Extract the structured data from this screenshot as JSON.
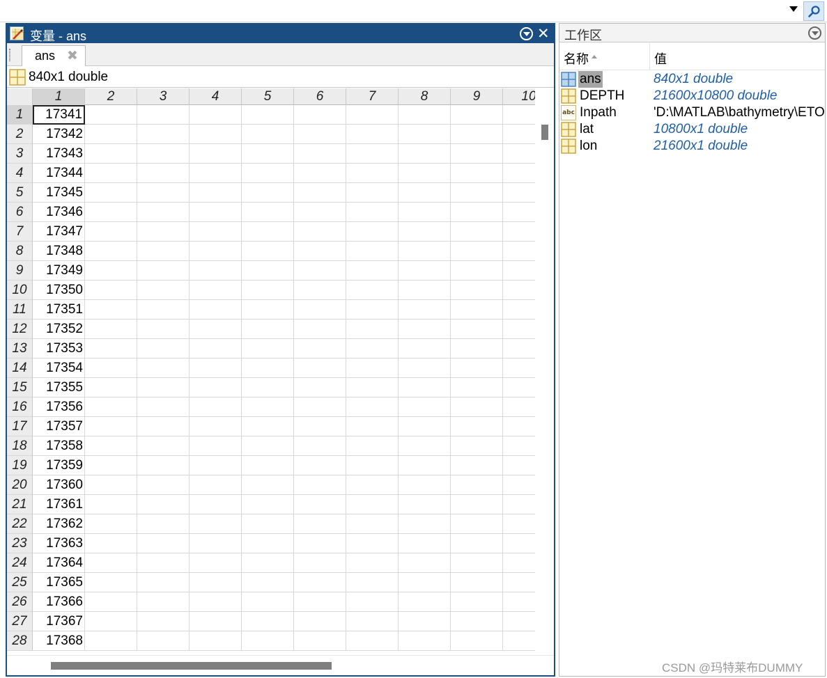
{
  "variable_editor": {
    "title": "变量 - ans",
    "tab_label": "ans",
    "size_label": "840x1 double",
    "column_headers": [
      "1",
      "2",
      "3",
      "4",
      "5",
      "6",
      "7",
      "8",
      "9",
      "10"
    ],
    "row_headers": [
      "1",
      "2",
      "3",
      "4",
      "5",
      "6",
      "7",
      "8",
      "9",
      "10",
      "11",
      "12",
      "13",
      "14",
      "15",
      "16",
      "17",
      "18",
      "19",
      "20",
      "21",
      "22",
      "23",
      "24",
      "25",
      "26",
      "27",
      "28"
    ],
    "values": [
      "17341",
      "17342",
      "17343",
      "17344",
      "17345",
      "17346",
      "17347",
      "17348",
      "17349",
      "17350",
      "17351",
      "17352",
      "17353",
      "17354",
      "17355",
      "17356",
      "17357",
      "17358",
      "17359",
      "17360",
      "17361",
      "17362",
      "17363",
      "17364",
      "17365",
      "17366",
      "17367",
      "17368"
    ],
    "selected_cell": {
      "row": 1,
      "column": 1
    }
  },
  "workspace": {
    "title": "工作区",
    "name_header": "名称",
    "value_header": "值",
    "variables": [
      {
        "name": "ans",
        "value": "840x1 double",
        "icon": "matrix-icon",
        "kind": "numeric",
        "selected": true
      },
      {
        "name": "DEPTH",
        "value": "21600x10800 double",
        "icon": "matrix-icon",
        "kind": "numeric",
        "selected": false
      },
      {
        "name": "Inpath",
        "value": "'D:\\MATLAB\\bathymetry\\ETO",
        "icon": "char-icon",
        "kind": "char",
        "selected": false
      },
      {
        "name": "lat",
        "value": "10800x1 double",
        "icon": "matrix-icon",
        "kind": "numeric",
        "selected": false
      },
      {
        "name": "lon",
        "value": "21600x1 double",
        "icon": "matrix-icon",
        "kind": "numeric",
        "selected": false
      }
    ]
  },
  "watermark": "CSDN @玛特莱布DUMMY",
  "colors": {
    "titlebar": "#1a4d82",
    "numeric_value_text": "#1f5fa8",
    "selection_gray": "#a6a6a6"
  }
}
